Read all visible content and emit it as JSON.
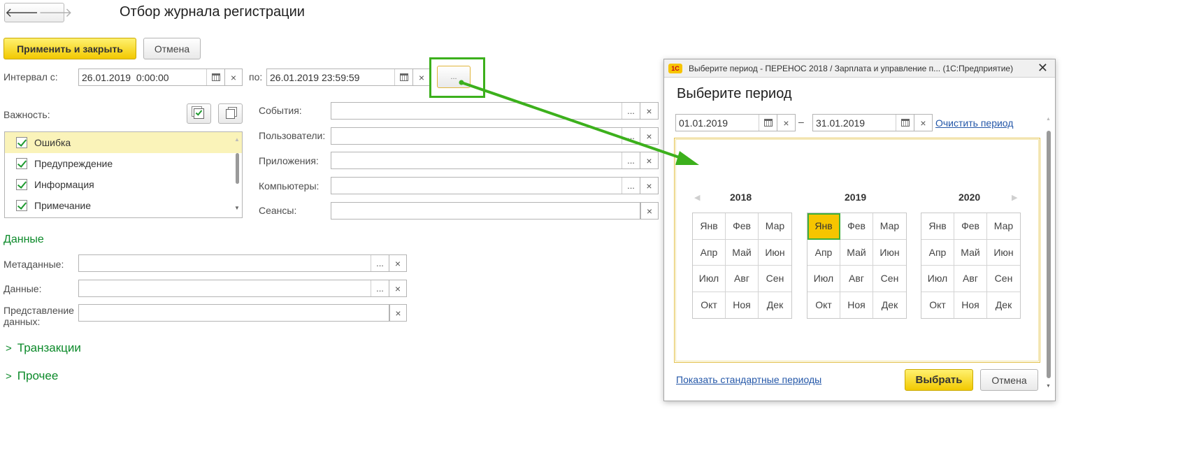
{
  "nav": {
    "back_icon": "arrow-left-icon",
    "forward_icon": "arrow-right-icon"
  },
  "form": {
    "title": "Отбор журнала регистрации",
    "apply_close_label": "Применить и закрыть",
    "cancel_label": "Отмена",
    "interval_from_label": "Интервал с:",
    "interval_from_value": "26.01.2019  0:00:00",
    "interval_to_label": "по:",
    "interval_to_value": "26.01.2019 23:59:59",
    "period_button_label": "...",
    "importance_label": "Важность:",
    "importance_items": [
      {
        "label": "Ошибка",
        "checked": true
      },
      {
        "label": "Предупреждение",
        "checked": true
      },
      {
        "label": "Информация",
        "checked": true
      },
      {
        "label": "Примечание",
        "checked": true
      }
    ],
    "events_label": "События:",
    "users_label": "Пользователи:",
    "apps_label": "Приложения:",
    "computers_label": "Компьютеры:",
    "sessions_label": "Сеансы:",
    "data_section_title": "Данные",
    "metadata_label": "Метаданные:",
    "data_label": "Данные:",
    "data_repr_label_1": "Представление",
    "data_repr_label_2": "данных:",
    "transactions_label": "Транзакции",
    "other_label": "Прочее",
    "select_btn": "...",
    "clear_btn": "×"
  },
  "dialog": {
    "window_title": "Выберите период - ПЕРЕНОС 2018 / Зарплата и управление п... (1С:Предприятие)",
    "logo_text": "1С",
    "title": "Выберите период",
    "date_from": "01.01.2019",
    "date_to": "31.01.2019",
    "dash": "–",
    "clear_period_link": "Очистить период",
    "show_standard_link": "Показать стандартные периоды",
    "select_button": "Выбрать",
    "cancel_button": "Отмена",
    "years": [
      "2018",
      "2019",
      "2020"
    ],
    "months": [
      "Янв",
      "Фев",
      "Мар",
      "Апр",
      "Май",
      "Июн",
      "Июл",
      "Авг",
      "Сен",
      "Окт",
      "Ноя",
      "Дек"
    ],
    "selected_year": "2019",
    "selected_month": "Янв",
    "prev_arrow": "◀",
    "next_arrow": "▶"
  },
  "colors": {
    "accent_green": "#3cb01c",
    "section_green": "#0c8a2a",
    "button_yellow": "#f6c500",
    "link_blue": "#2457a8"
  }
}
